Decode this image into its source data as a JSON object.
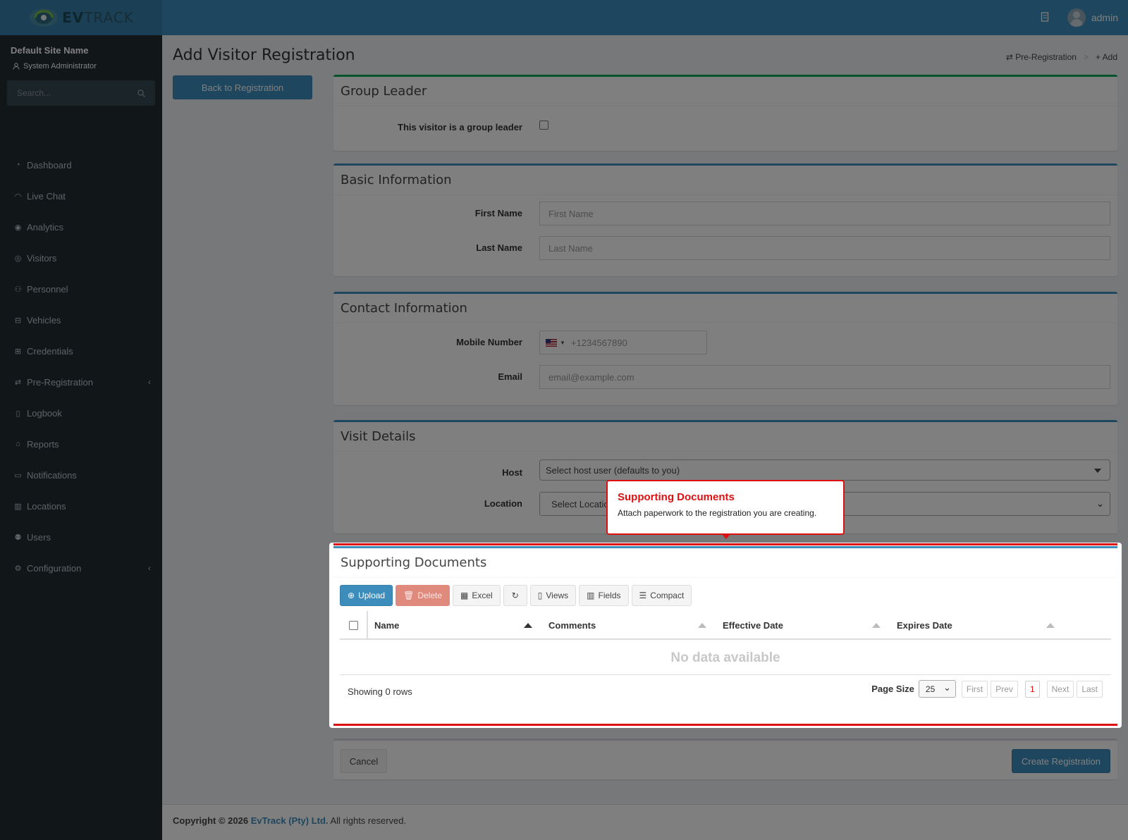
{
  "header": {
    "logo_text_a": "EV",
    "logo_text_b": "TRACK",
    "user_name": "admin"
  },
  "sidebar": {
    "site_name": "Default Site Name",
    "role": "System Administrator",
    "search_placeholder": "Search...",
    "items": [
      {
        "label": "Dashboard",
        "icon": "dashboard-icon"
      },
      {
        "label": "Live Chat",
        "icon": "headset-icon"
      },
      {
        "label": "Analytics",
        "icon": "analytics-icon"
      },
      {
        "label": "Visitors",
        "icon": "eye-icon"
      },
      {
        "label": "Personnel",
        "icon": "person-icon"
      },
      {
        "label": "Vehicles",
        "icon": "car-icon"
      },
      {
        "label": "Credentials",
        "icon": "badge-icon"
      },
      {
        "label": "Pre-Registration",
        "icon": "arrows-icon"
      },
      {
        "label": "Logbook",
        "icon": "book-icon"
      },
      {
        "label": "Reports",
        "icon": "chart-icon"
      },
      {
        "label": "Notifications",
        "icon": "message-icon"
      },
      {
        "label": "Locations",
        "icon": "map-icon"
      },
      {
        "label": "Users",
        "icon": "users-icon"
      },
      {
        "label": "Configuration",
        "icon": "gear-icon"
      }
    ]
  },
  "page": {
    "title": "Add Visitor Registration",
    "breadcrumb": [
      "Pre-Registration",
      "Add"
    ],
    "back_button": "Back to Registration"
  },
  "group_leader": {
    "title": "Group Leader",
    "checkbox_label": "This visitor is a group leader"
  },
  "basic_info": {
    "title": "Basic Information",
    "first_name_label": "First Name",
    "first_name_placeholder": "First Name",
    "last_name_label": "Last Name",
    "last_name_placeholder": "Last Name"
  },
  "contact_info": {
    "title": "Contact Information",
    "mobile_label": "Mobile Number",
    "mobile_placeholder": "+1234567890",
    "email_label": "Email",
    "email_placeholder": "email@example.com"
  },
  "visit_details": {
    "title": "Visit Details",
    "host_label": "Host",
    "host_value": "Select host user (defaults to you)",
    "location_label": "Location",
    "location_value": "Select Location"
  },
  "documents": {
    "title": "Supporting Documents",
    "toolbar": [
      "Upload",
      "Delete",
      "Excel",
      "",
      "Views",
      "Fields",
      "Compact"
    ],
    "columns": [
      "Name",
      "Comments",
      "Effective Date",
      "Expires Date"
    ],
    "empty_text": "No data available",
    "showing": "Showing 0 rows",
    "page_size_label": "Page Size",
    "page_size": "25",
    "pager": [
      "First",
      "Prev",
      "1",
      "Next",
      "Last"
    ]
  },
  "tooltip": {
    "title": "Supporting Documents",
    "body": "Attach paperwork to the registration you are creating."
  },
  "actions": {
    "cancel": "Cancel",
    "create": "Create Registration"
  },
  "footer": {
    "prefix": "Copyright © 2026",
    "company": "EvTrack (Pty) Ltd.",
    "suffix": "All rights reserved."
  },
  "colors": {
    "primary": "#3c8dbc",
    "sidebar": "#222d32",
    "highlight": "#dd1111",
    "success": "#00a65a"
  }
}
